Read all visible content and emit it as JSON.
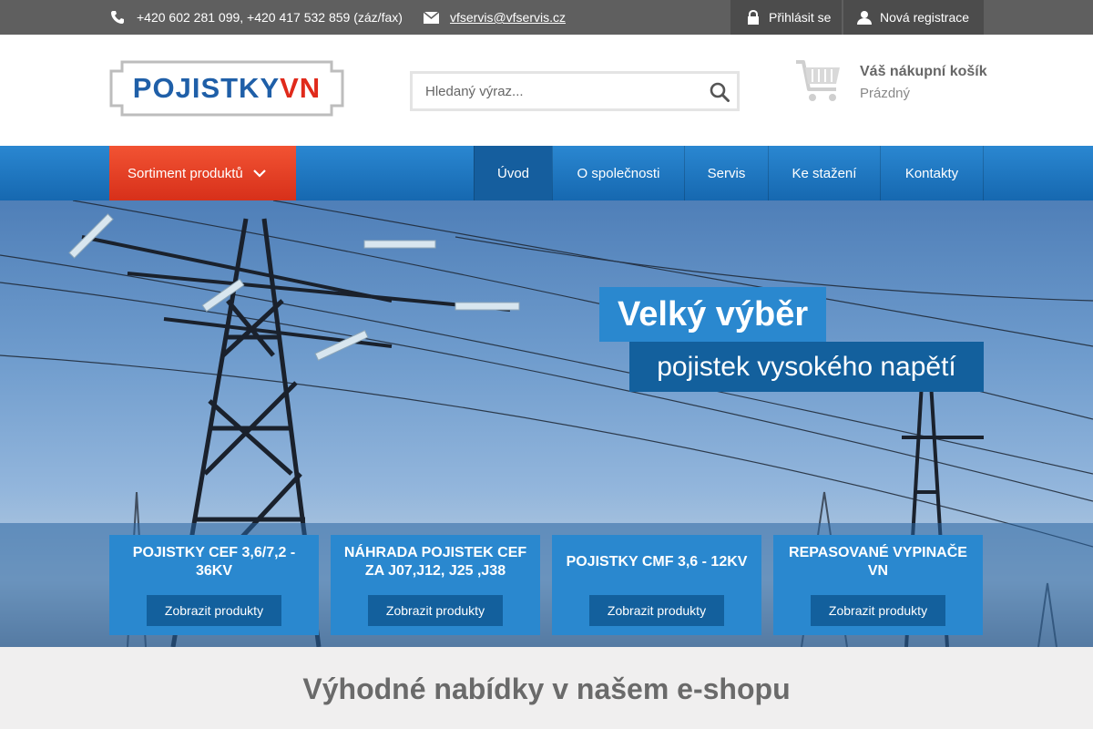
{
  "topbar": {
    "phone": "+420 602 281 099, +420 417 532 859 (záz/fax)",
    "email": "vfservis@vfservis.cz",
    "login": "Přihlásit se",
    "register": "Nová registrace"
  },
  "header": {
    "logo_part1": "POJISTKY",
    "logo_part2": "VN",
    "search_placeholder": "Hledaný výraz...",
    "cart_title": "Váš nákupní košík",
    "cart_state": "Prázdný"
  },
  "nav": {
    "sortiment": "Sortiment produktů",
    "items": [
      {
        "label": "Úvod",
        "active": true
      },
      {
        "label": "O společnosti",
        "active": false
      },
      {
        "label": "Servis",
        "active": false
      },
      {
        "label": "Ke stažení",
        "active": false
      },
      {
        "label": "Kontakty",
        "active": false
      }
    ]
  },
  "hero": {
    "headline": "Velký výběr",
    "subline": "pojistek vysokého napětí",
    "cards": [
      {
        "title": "POJISTKY CEF 3,6/7,2 - 36KV",
        "button": "Zobrazit produkty"
      },
      {
        "title": "NÁHRADA POJISTEK CEF ZA J07,J12, J25 ,J38",
        "button": "Zobrazit produkty"
      },
      {
        "title": "POJISTKY CMF 3,6 - 12KV",
        "button": "Zobrazit produkty"
      },
      {
        "title": "REPASOVANÉ VYPINAČE VN",
        "button": "Zobrazit produkty"
      }
    ]
  },
  "offers": {
    "heading": "Výhodné nabídky v našem e-shopu"
  },
  "colors": {
    "topbar": "#5f5f5f",
    "nav_blue": "#1e78c2",
    "accent_red": "#e23d22",
    "card_blue": "#2a88cf",
    "dark_blue": "#13609d",
    "logo_blue": "#1f5fa8",
    "logo_red": "#e02a1b"
  },
  "icons": [
    "phone-icon",
    "envelope-icon",
    "lock-icon",
    "user-icon",
    "search-icon",
    "cart-icon",
    "chevron-down-icon"
  ]
}
